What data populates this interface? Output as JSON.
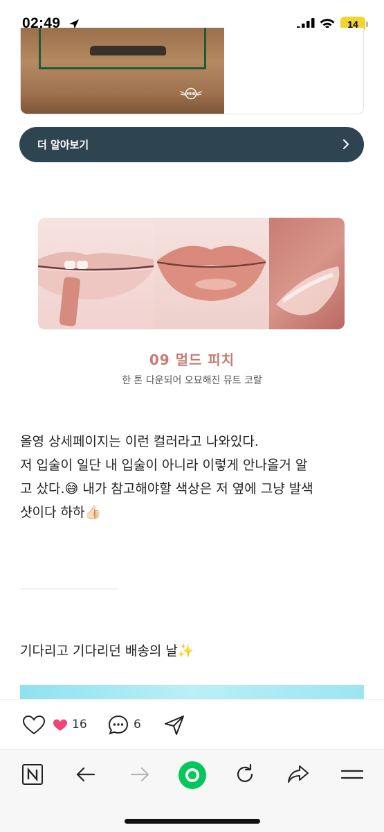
{
  "status_bar": {
    "time": "02:49",
    "battery": "14",
    "icons": [
      "location-arrow-icon",
      "signal-icon",
      "wifi-icon",
      "battery-icon"
    ]
  },
  "ad": {
    "logo_text": "MINI",
    "cta_label": "더 알아보기",
    "cta_icon": "chevron-right-icon",
    "button_color": "#2e4551"
  },
  "product": {
    "shade_name": "09 멀드 피치",
    "shade_desc": "한 톤 다운되어 오묘해진 뮤트 코랄",
    "shade_color": "#c57c72"
  },
  "post": {
    "lines": [
      "올영 상세페이지는 이런 컬러라고 나와있다.",
      "저 입술이 일단 내 입술이 아니라 이렇게 안나올거 알",
      "고 샀다.😅 내가 참고해야할 색상은 저 옆에 그냥 발색",
      "샷이다 하하👍🏻"
    ],
    "para2": "기다리고 기다리던 배송의 날✨"
  },
  "reactions": {
    "like_count": "16",
    "comment_count": "6",
    "icons": [
      "heart-outline-icon",
      "heart-badge-icon",
      "comment-icon",
      "send-icon"
    ]
  },
  "toolbar": {
    "icons": [
      "naver-n-icon",
      "back-arrow-icon",
      "forward-arrow-icon",
      "green-home-icon",
      "reload-icon",
      "share-icon",
      "menu-icon"
    ],
    "accent": "#03c75a"
  }
}
